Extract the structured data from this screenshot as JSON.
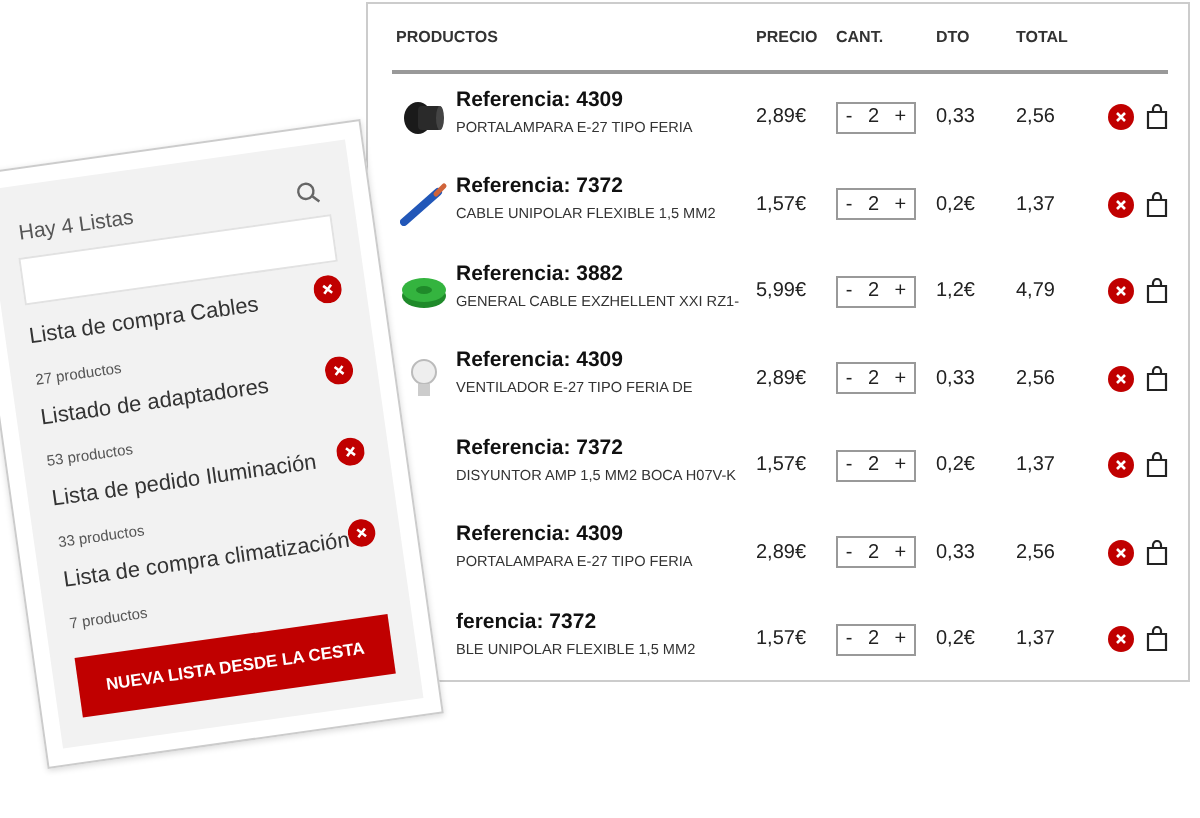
{
  "cart_table": {
    "columns": [
      "PRODUCTOS",
      "PRECIO",
      "CANT.",
      "DTO",
      "TOTAL"
    ],
    "rows": [
      {
        "kind": "socket",
        "reference": "Referencia: 4309",
        "description": "PORTALAMPARA E-27 TIPO FERIA",
        "price": "2,89€",
        "qty": {
          "minus": "-",
          "value": "2",
          "plus": "+"
        },
        "discount": "0,33",
        "total": "2,56"
      },
      {
        "kind": "cable",
        "reference": "Referencia: 7372",
        "description": "CABLE UNIPOLAR FLEXIBLE 1,5 MM2",
        "price": "1,57€",
        "qty": {
          "minus": "-",
          "value": "2",
          "plus": "+"
        },
        "discount": "0,2€",
        "total": "1,37"
      },
      {
        "kind": "reel",
        "reference": "Referencia: 3882",
        "description": "GENERAL CABLE EXZHELLENT XXI RZ1-",
        "price": "5,99€",
        "qty": {
          "minus": "-",
          "value": "2",
          "plus": "+"
        },
        "discount": "1,2€",
        "total": "4,79"
      },
      {
        "kind": "bulb",
        "reference": "Referencia: 4309",
        "description": "VENTILADOR E-27 TIPO FERIA DE",
        "price": "2,89€",
        "qty": {
          "minus": "-",
          "value": "2",
          "plus": "+"
        },
        "discount": "0,33",
        "total": "2,56"
      },
      {
        "reference": "Referencia: 7372",
        "description": "DISYUNTOR AMP 1,5 MM2 BOCA H07V-K",
        "price": "1,57€",
        "qty": {
          "minus": "-",
          "value": "2",
          "plus": "+"
        },
        "discount": "0,2€",
        "total": "1,37"
      },
      {
        "reference": "Referencia: 4309",
        "description": "PORTALAMPARA E-27 TIPO FERIA",
        "price": "2,89€",
        "qty": {
          "minus": "-",
          "value": "2",
          "plus": "+"
        },
        "discount": "0,33",
        "total": "2,56"
      },
      {
        "reference": "ferencia: 7372",
        "description": "BLE UNIPOLAR FLEXIBLE 1,5 MM2",
        "price": "1,57€",
        "qty": {
          "minus": "-",
          "value": "2",
          "plus": "+"
        },
        "discount": "0,2€",
        "total": "1,37"
      }
    ]
  },
  "lists_panel": {
    "title": "Hay 4 Listas",
    "lists": [
      {
        "name": "Lista de compra Cables",
        "count": "27 productos"
      },
      {
        "name": "Listado de adaptadores",
        "count": "53 productos"
      },
      {
        "name": "Lista de pedido Iluminación",
        "count": "33 productos"
      },
      {
        "name": "Lista de compra climatización",
        "count": "7 productos"
      }
    ],
    "button": "NUEVA LISTA DESDE LA CESTA"
  }
}
